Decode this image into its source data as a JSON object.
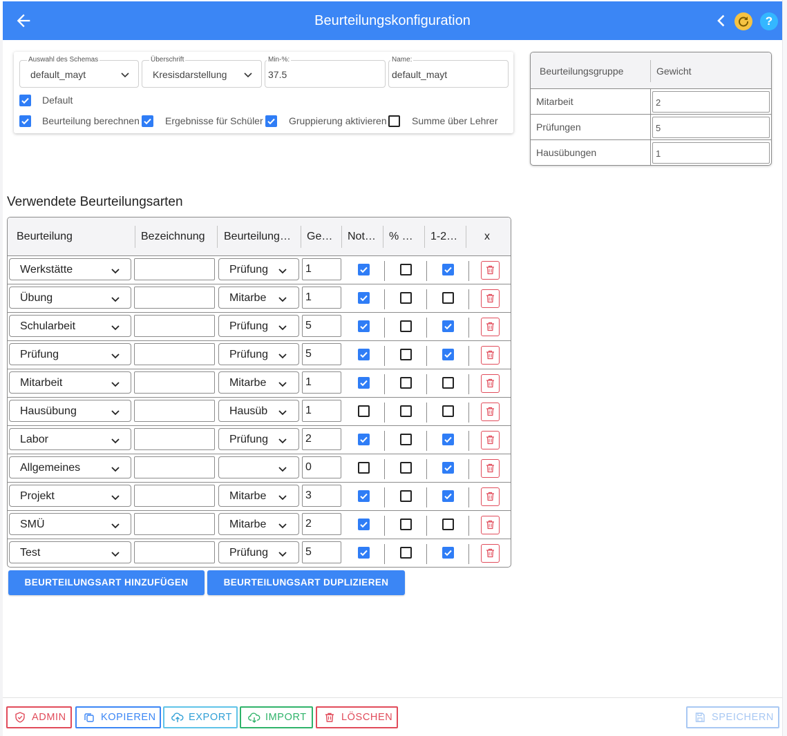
{
  "header": {
    "title": "Beurteilungskonfiguration",
    "help_label": "?"
  },
  "config": {
    "schema": {
      "label": "Auswahl des Schemas",
      "value": "default_mayt"
    },
    "heading": {
      "label": "Überschrift",
      "value": "Kresisdarstellung"
    },
    "min_percent": {
      "label": "Min-%:",
      "value": "37.5"
    },
    "name": {
      "label": "Name:",
      "value": "default_mayt"
    },
    "checkboxes": [
      {
        "label": "Default",
        "checked": true
      },
      {
        "label": "Beurteilung berechnen",
        "checked": true
      },
      {
        "label": "Ergebnisse für Schüler",
        "checked": true
      },
      {
        "label": "Gruppierung aktivieren",
        "checked": true
      },
      {
        "label": "Summe über Lehrer",
        "checked": false
      }
    ]
  },
  "group_weights": {
    "headers": [
      "Beurteilungsgruppe",
      "Gewicht"
    ],
    "rows": [
      {
        "group": "Mitarbeit",
        "weight": "2"
      },
      {
        "group": "Prüfungen",
        "weight": "5"
      },
      {
        "group": "Hausübungen",
        "weight": "1"
      }
    ]
  },
  "section_title": "Verwendete Beurteilungsarten",
  "table": {
    "headers": [
      "Beurteilung",
      "Bezeichnung",
      "Beurteilung…",
      "Ge…",
      "Not…",
      "% …",
      "1-2…",
      "x"
    ],
    "rows": [
      {
        "type": "Werkstätte",
        "label": "",
        "group": "Prüfung",
        "weight": "1",
        "note": true,
        "pct": false,
        "onetwo": true
      },
      {
        "type": "Übung",
        "label": "",
        "group": "Mitarbe",
        "weight": "1",
        "note": true,
        "pct": false,
        "onetwo": false
      },
      {
        "type": "Schularbeit",
        "label": "",
        "group": "Prüfung",
        "weight": "5",
        "note": true,
        "pct": false,
        "onetwo": true
      },
      {
        "type": "Prüfung",
        "label": "",
        "group": "Prüfung",
        "weight": "5",
        "note": true,
        "pct": false,
        "onetwo": true
      },
      {
        "type": "Mitarbeit",
        "label": "",
        "group": "Mitarbe",
        "weight": "1",
        "note": true,
        "pct": false,
        "onetwo": false
      },
      {
        "type": "Hausübung",
        "label": "",
        "group": "Hausüb",
        "weight": "1",
        "note": false,
        "pct": false,
        "onetwo": false
      },
      {
        "type": "Labor",
        "label": "",
        "group": "Prüfung",
        "weight": "2",
        "note": true,
        "pct": false,
        "onetwo": true
      },
      {
        "type": "Allgemeines",
        "label": "",
        "group": "",
        "weight": "0",
        "note": false,
        "pct": false,
        "onetwo": true
      },
      {
        "type": "Projekt",
        "label": "",
        "group": "Mitarbe",
        "weight": "3",
        "note": true,
        "pct": false,
        "onetwo": true
      },
      {
        "type": "SMÜ",
        "label": "",
        "group": "Mitarbe",
        "weight": "2",
        "note": true,
        "pct": false,
        "onetwo": false
      },
      {
        "type": "Test",
        "label": "",
        "group": "Prüfung",
        "weight": "5",
        "note": true,
        "pct": false,
        "onetwo": true
      }
    ]
  },
  "actions": {
    "add": "BEURTEILUNGSART HINZUFÜGEN",
    "duplicate": "BEURTEILUNGSART DUPLIZIEREN"
  },
  "footer": {
    "admin": "ADMIN",
    "copy": "KOPIEREN",
    "export": "EXPORT",
    "import": "IMPORT",
    "delete": "LÖSCHEN",
    "save": "SPEICHERN"
  },
  "colors": {
    "primary": "#3b86f5",
    "danger": "#e14b5a",
    "info": "#2f9fd6",
    "success": "#2fb36a",
    "disabled": "#a8c8f3",
    "refresh": "#f6c343",
    "help": "#34b7ff"
  },
  "icons": [
    "arrow-left-icon",
    "chevron-left-icon",
    "refresh-icon",
    "help-icon",
    "chevron-down-icon",
    "trash-icon",
    "shield-icon",
    "copy-icon",
    "cloud-upload-icon",
    "cloud-download-icon",
    "save-icon"
  ]
}
